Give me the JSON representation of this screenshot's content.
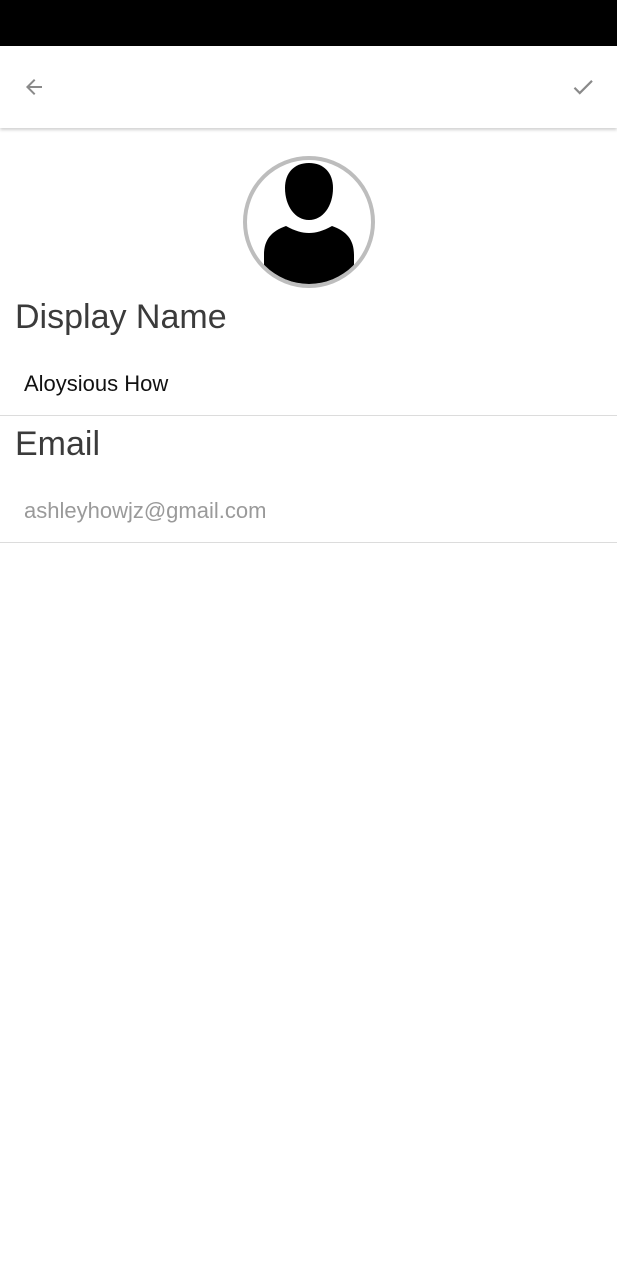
{
  "toolbar": {
    "back_icon": "arrow-left-icon",
    "save_icon": "checkmark-icon",
    "icon_color": "#8a8a8a"
  },
  "profile": {
    "avatar_icon": "person-silhouette-icon",
    "avatar_border_color": "#bdbdbd"
  },
  "fields": {
    "display_name": {
      "label": "Display Name",
      "value": "Aloysious How"
    },
    "email": {
      "label": "Email",
      "value": "ashleyhowjz@gmail.com"
    }
  }
}
